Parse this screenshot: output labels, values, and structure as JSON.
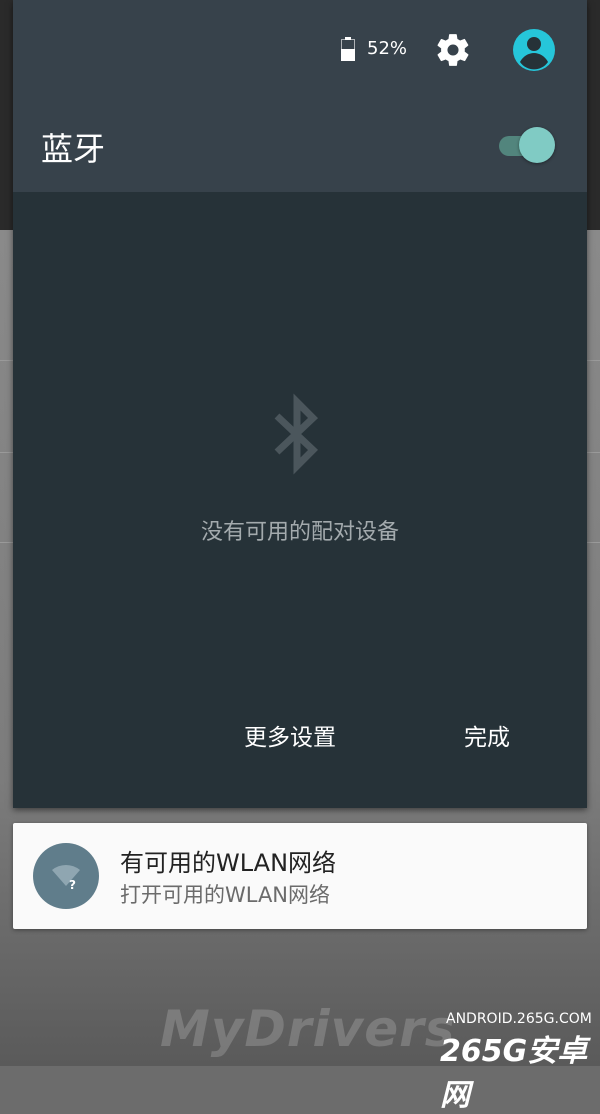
{
  "status_bar": {
    "battery_percent": "52%"
  },
  "bluetooth_panel": {
    "title": "蓝牙",
    "toggle_on": true,
    "empty_message": "没有可用的配对设备",
    "more_settings_label": "更多设置",
    "done_label": "完成"
  },
  "notification": {
    "title": "有可用的WLAN网络",
    "subtitle": "打开可用的WLAN网络",
    "icon": "wifi-question-icon"
  },
  "watermark": {
    "text": "MyDrivers",
    "site": "ANDROID.265G.COM",
    "brand": "265G安卓网"
  },
  "colors": {
    "panel_bg": "#263238",
    "panel_header": "#37424b",
    "accent": "#80cbc4",
    "avatar": "#26c6da",
    "notification_icon_bg": "#607d8b"
  }
}
